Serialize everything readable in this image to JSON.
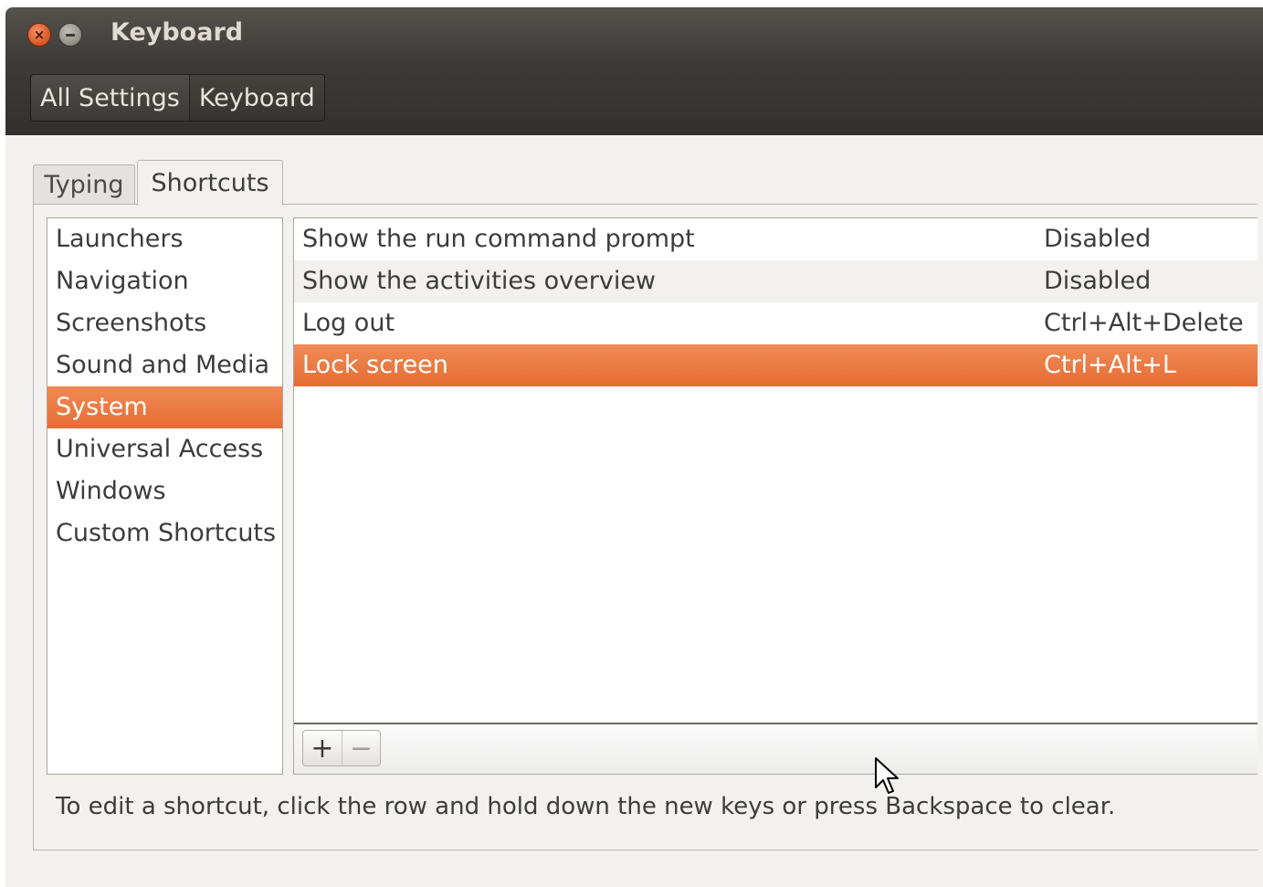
{
  "window": {
    "title": "Keyboard",
    "close_glyph": "×"
  },
  "breadcrumbs": [
    {
      "label": "All Settings"
    },
    {
      "label": "Keyboard"
    }
  ],
  "tabs": [
    {
      "label": "Typing"
    },
    {
      "label": "Shortcuts"
    }
  ],
  "categories": [
    {
      "label": "Launchers"
    },
    {
      "label": "Navigation"
    },
    {
      "label": "Screenshots"
    },
    {
      "label": "Sound and Media"
    },
    {
      "label": "System",
      "selected": true
    },
    {
      "label": "Universal Access"
    },
    {
      "label": "Windows"
    },
    {
      "label": "Custom Shortcuts"
    }
  ],
  "shortcuts": [
    {
      "action": "Show the run command prompt",
      "accel": "Disabled"
    },
    {
      "action": "Show the activities overview",
      "accel": "Disabled"
    },
    {
      "action": "Log out",
      "accel": "Ctrl+Alt+Delete"
    },
    {
      "action": "Lock screen",
      "accel": "Ctrl+Alt+L",
      "selected": true
    }
  ],
  "table_buttons": {
    "add_glyph": "+",
    "remove_glyph": "−"
  },
  "hint": "To edit a shortcut, click the row and hold down the new keys or press Backspace to clear.",
  "colors": {
    "selection": "#e96f36",
    "titlebar": "#3e3b38",
    "close_button": "#df5a22"
  }
}
